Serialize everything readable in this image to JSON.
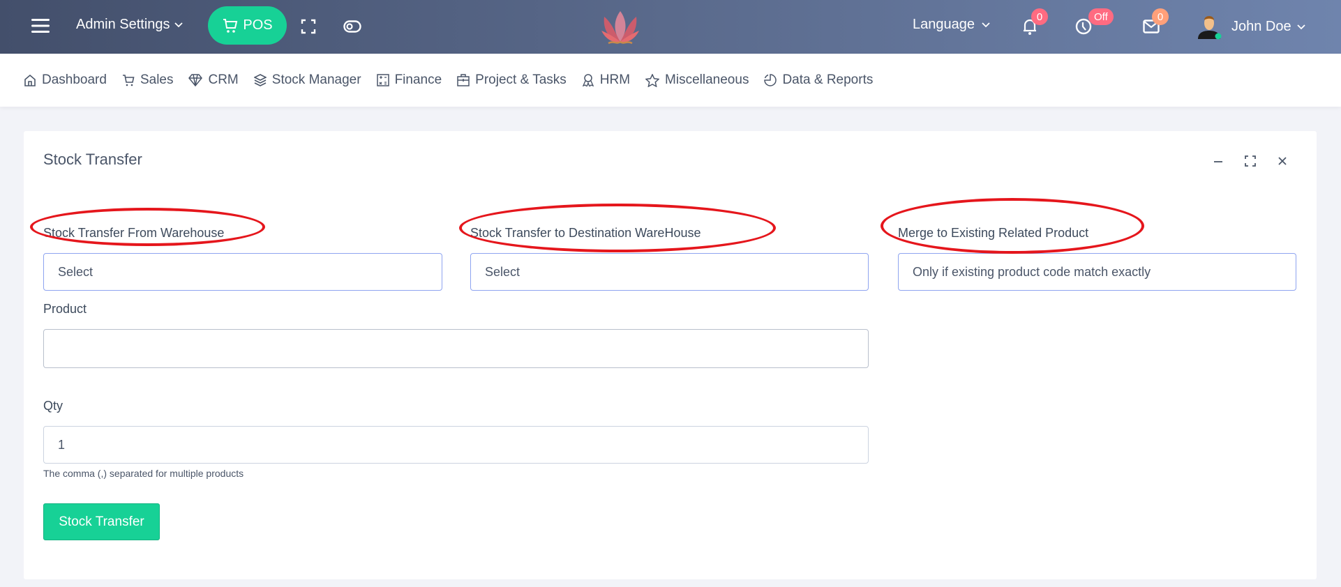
{
  "header": {
    "admin_settings": "Admin Settings",
    "pos_label": "POS",
    "language": "Language",
    "notifications_count": "0",
    "clock_status": "Off",
    "messages_count": "0",
    "user_name": "John Doe"
  },
  "nav": {
    "items": [
      {
        "label": "Dashboard",
        "icon": "home-icon"
      },
      {
        "label": "Sales",
        "icon": "cart-icon"
      },
      {
        "label": "CRM",
        "icon": "diamond-icon"
      },
      {
        "label": "Stock Manager",
        "icon": "layers-icon"
      },
      {
        "label": "Finance",
        "icon": "calculator-icon"
      },
      {
        "label": "Project & Tasks",
        "icon": "briefcase-icon"
      },
      {
        "label": "HRM",
        "icon": "award-icon"
      },
      {
        "label": "Miscellaneous",
        "icon": "star-icon"
      },
      {
        "label": "Data & Reports",
        "icon": "pie-chart-icon"
      }
    ]
  },
  "card": {
    "title": "Stock Transfer",
    "from_label": "Stock Transfer From Warehouse",
    "from_value": "Select",
    "to_label": "Stock Transfer to Destination WareHouse",
    "to_value": "Select",
    "merge_label": "Merge to Existing Related Product",
    "merge_value": "Only if existing product code match exactly",
    "product_label": "Product",
    "product_value": "",
    "qty_label": "Qty",
    "qty_value": "1",
    "help_text": "The comma (,) separated for multiple products",
    "submit_label": "Stock Transfer"
  },
  "colors": {
    "accent": "#17d196",
    "badge_red": "#ff6b81",
    "badge_orange": "#ffa07a",
    "annotation": "#e5161c"
  }
}
